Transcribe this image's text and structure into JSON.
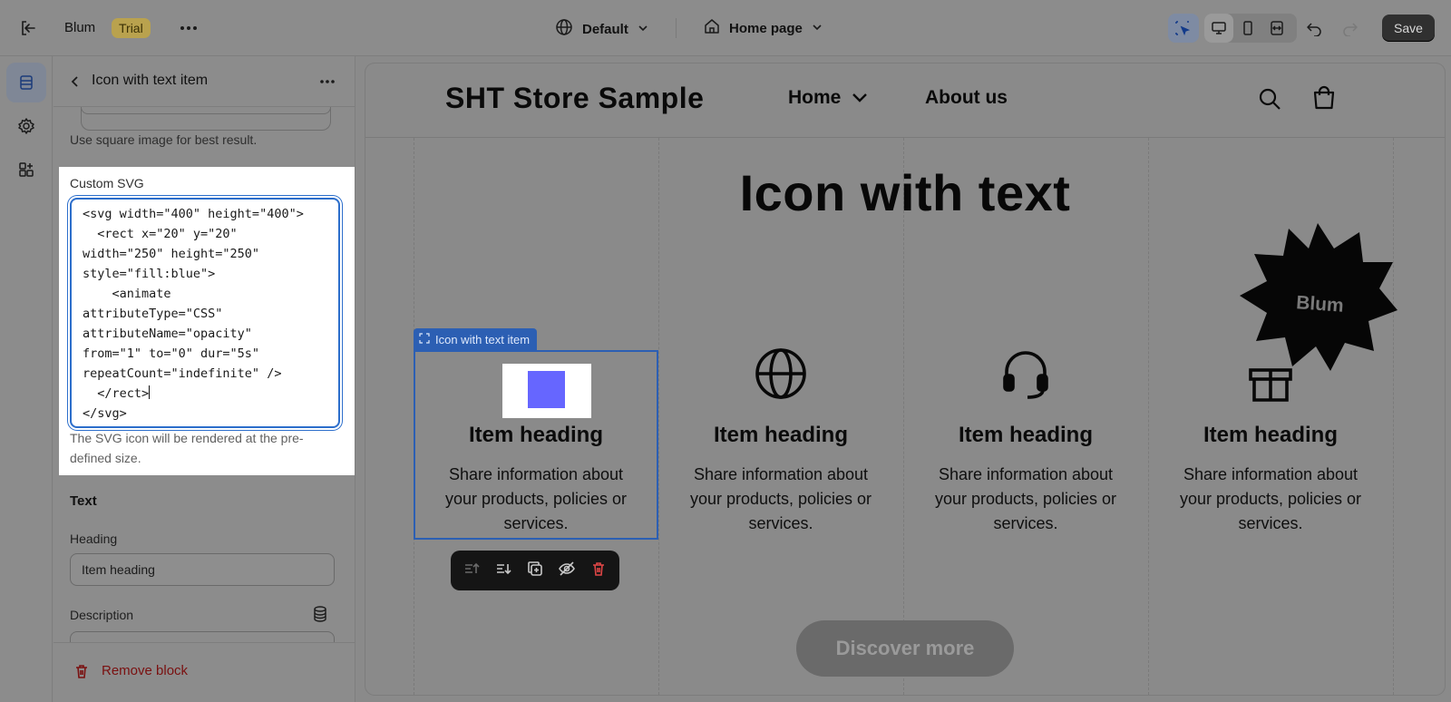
{
  "topbar": {
    "store_name": "Blum",
    "plan_badge": "Trial",
    "theme_selector": "Default",
    "page_selector": "Home page",
    "save_label": "Save"
  },
  "panel": {
    "title": "Icon with text item",
    "image_hint": "Use square image for best result.",
    "custom_svg": {
      "label": "Custom SVG",
      "code_lines": [
        "<svg width=\"400\" height=\"400\">",
        "  <rect x=\"20\" y=\"20\"",
        "width=\"250\" height=\"250\"",
        "style=\"fill:blue\">",
        "    <animate",
        "attributeType=\"CSS\"",
        "attributeName=\"opacity\"",
        "from=\"1\" to=\"0\" dur=\"5s\"",
        "repeatCount=\"indefinite\" />",
        "  </rect>",
        "</svg>"
      ],
      "description": "The SVG icon will be rendered at the pre-defined size."
    },
    "text_section": {
      "title": "Text",
      "heading_label": "Heading",
      "heading_value": "Item heading",
      "description_label": "Description"
    },
    "remove_label": "Remove block"
  },
  "preview": {
    "store_title": "SHT Store Sample",
    "nav": [
      "Home",
      "About us"
    ],
    "section_heading": "Icon with text",
    "selected_tag": "Icon with text item",
    "items": [
      {
        "icon": "custom-svg-image",
        "heading": "Item heading",
        "text": "Share information about your products, policies or services."
      },
      {
        "icon": "globe-icon",
        "heading": "Item heading",
        "text": "Share information about your products, policies or services."
      },
      {
        "icon": "headset-icon",
        "heading": "Item heading",
        "text": "Share information about your products, policies or services."
      },
      {
        "icon": "gift-icon",
        "heading": "Item heading",
        "text": "Share information about your products, policies or services."
      }
    ],
    "badge_text": "Blum",
    "button_label": "Discover more"
  },
  "colors": {
    "accent": "#2c5fb3",
    "svg_fill": "#6666ff",
    "danger": "#e04646"
  }
}
